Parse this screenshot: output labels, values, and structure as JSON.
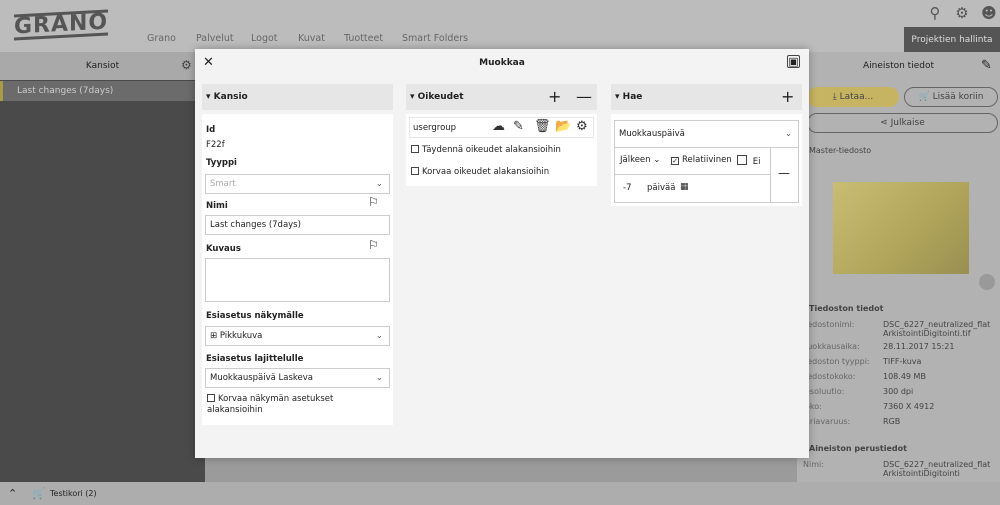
{
  "header": {
    "logo": "GRANO",
    "nav": [
      "Grano",
      "Palvelut",
      "Logot",
      "Kuvat",
      "Tuotteet",
      "Smart Folders"
    ],
    "projects_button": "Projektien hallinta"
  },
  "sidebar": {
    "title": "Kansiot",
    "items": [
      {
        "label": "Last changes (7days)"
      }
    ]
  },
  "bottom": {
    "cart": "Testikori (2)"
  },
  "right_panel": {
    "title": "Aineiston tiedot",
    "download": "Lataa...",
    "add_to_cart": "Lisää koriin",
    "publish": "Julkaise",
    "master_section": "Master-tiedosto",
    "file_info_title": "Tiedoston tiedot",
    "file_info": [
      {
        "k": "iedostonimi:",
        "v": "DSC_6227_neutralized_flat ArkistointiDigitointi.tif"
      },
      {
        "k": "luokkausaika:",
        "v": "28.11.2017 15:21"
      },
      {
        "k": "iedoston tyyppi:",
        "v": "TIFF-kuva"
      },
      {
        "k": "iedostokoko:",
        "v": "108.49 MB"
      },
      {
        "k": "esoluutio:",
        "v": "300 dpi"
      },
      {
        "k": "oko:",
        "v": "7360 X 4912"
      },
      {
        "k": "äriavaruus:",
        "v": "RGB"
      }
    ],
    "basic_title": "Aineiston perustiedot",
    "basic": [
      {
        "k": "Nimi:",
        "v": "DSC_6227_neutralized_flat ArkistointiDigitointi"
      }
    ]
  },
  "modal": {
    "title": "Muokkaa",
    "kansio": {
      "title": "Kansio",
      "id_label": "Id",
      "id_value": "F22f",
      "type_label": "Tyyppi",
      "type_value": "Smart",
      "name_label": "Nimi",
      "name_value": "Last changes (7days)",
      "desc_label": "Kuvaus",
      "desc_value": "",
      "view_label": "Esiasetus näkymälle",
      "view_value": "Pikkukuva",
      "sort_label": "Esiasetus lajittelulle",
      "sort_value": "Muokkauspäivä Laskeva",
      "override_label": "Korvaa näkymän asetukset alakansioihin"
    },
    "oikeudet": {
      "title": "Oikeudet",
      "group": "usergroup",
      "opt1": "Täydennä oikeudet alakansioihin",
      "opt2": "Korvaa oikeudet alakansioihin"
    },
    "hae": {
      "title": "Hae",
      "field": "Muokkauspäivä",
      "op": "Jälkeen",
      "relative_label": "Relatiivinen",
      "relative_checked": true,
      "not_label": "Ei",
      "value": "-7",
      "unit": "päivää"
    }
  }
}
